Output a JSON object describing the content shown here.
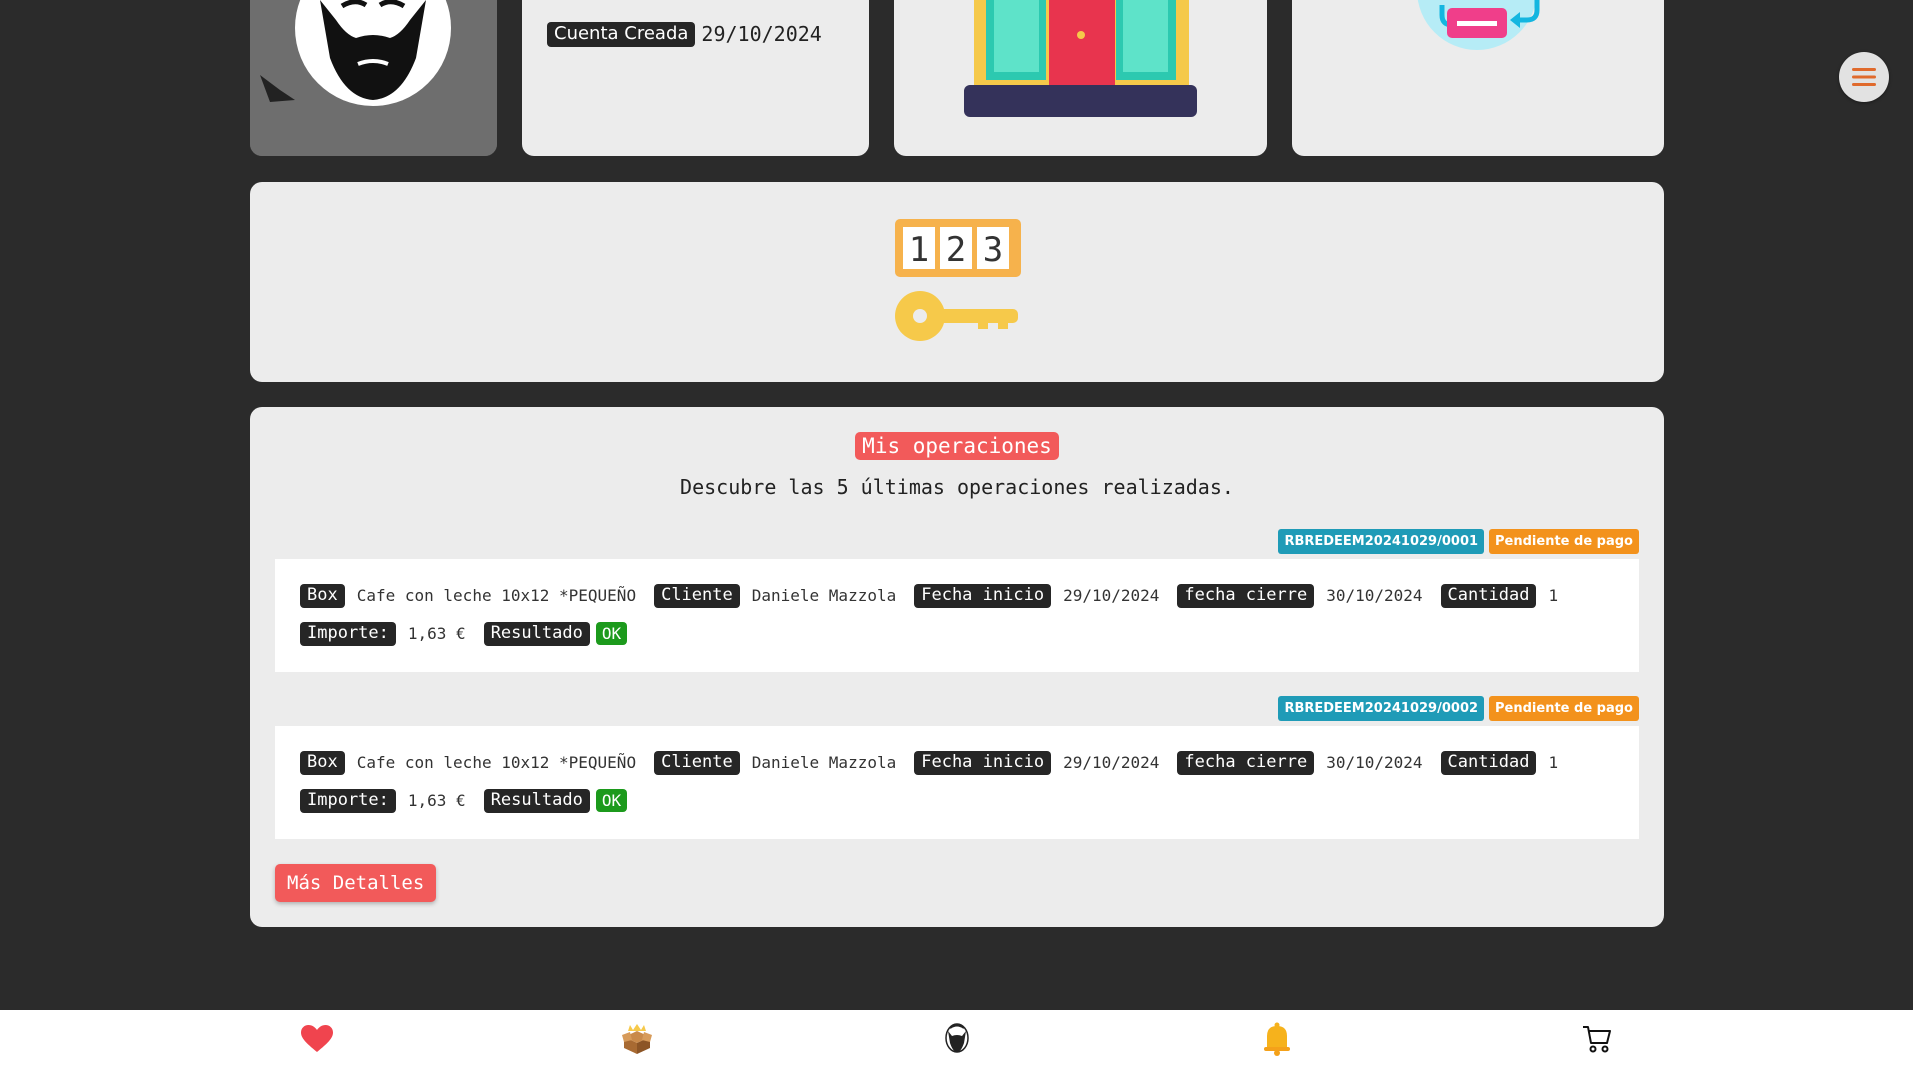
{
  "account": {
    "label": "Cuenta Creada",
    "date": "29/10/2024"
  },
  "operations": {
    "title": "Mis operaciones",
    "subtitle": "Descubre las 5 últimas operaciones realizadas.",
    "items": [
      {
        "id": "RBREDEEM20241029/0001",
        "status": "Pendiente de pago",
        "box_label": "Box",
        "box": "Cafe con leche 10x12 *PEQUEÑO",
        "client_label": "Cliente",
        "client": "Daniele Mazzola",
        "start_label": "Fecha inicio",
        "start": "29/10/2024",
        "end_label": "fecha cierre",
        "end": "30/10/2024",
        "qty_label": "Cantidad",
        "qty": "1",
        "amount_label": "Importe:",
        "amount": "1,63 €",
        "result_label": "Resultado",
        "result": "OK"
      },
      {
        "id": "RBREDEEM20241029/0002",
        "status": "Pendiente de pago",
        "box_label": "Box",
        "box": "Cafe con leche 10x12 *PEQUEÑO",
        "client_label": "Cliente",
        "client": "Daniele Mazzola",
        "start_label": "Fecha inicio",
        "start": "29/10/2024",
        "end_label": "fecha cierre",
        "end": "30/10/2024",
        "qty_label": "Cantidad",
        "qty": "1",
        "amount_label": "Importe:",
        "amount": "1,63 €",
        "result_label": "Resultado",
        "result": "OK"
      }
    ],
    "more_button": "Más Detalles"
  },
  "code_card": {
    "digits": [
      "1",
      "2",
      "3"
    ]
  },
  "nav": {
    "icons": [
      "heart-icon",
      "gift-box-icon",
      "profile-avatar-icon",
      "bell-icon",
      "cart-icon"
    ]
  },
  "colors": {
    "accent": "#f25a5a",
    "id_badge": "#1f9bb7",
    "status_badge": "#f3921c",
    "ok": "#1c9a1c"
  }
}
